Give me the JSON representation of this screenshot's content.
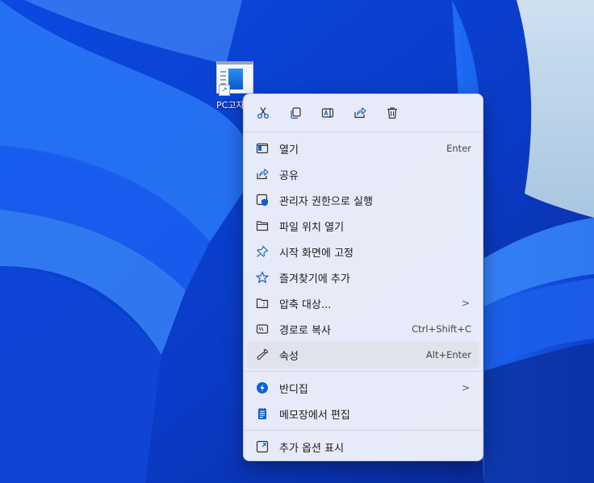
{
  "desktop": {
    "icon_label": "PC고자"
  },
  "toolbar": [
    {
      "name": "cut-icon"
    },
    {
      "name": "copy-icon"
    },
    {
      "name": "rename-icon"
    },
    {
      "name": "share-icon"
    },
    {
      "name": "delete-icon"
    }
  ],
  "menu": {
    "open": {
      "label": "열기",
      "shortcut": "Enter",
      "icon": "window-open-icon"
    },
    "share": {
      "label": "공유",
      "icon": "share-icon"
    },
    "run_admin": {
      "label": "관리자 권한으로 실행",
      "icon": "shield-window-icon"
    },
    "open_location": {
      "label": "파일 위치 열기",
      "icon": "folder-icon"
    },
    "pin_start": {
      "label": "시작 화면에 고정",
      "icon": "pin-icon"
    },
    "add_favorites": {
      "label": "즐겨찾기에 추가",
      "icon": "star-icon"
    },
    "compress": {
      "label": "압축 대상...",
      "icon": "zip-folder-icon"
    },
    "copy_path": {
      "label": "경로로 복사",
      "shortcut": "Ctrl+Shift+C",
      "icon": "path-icon"
    },
    "properties": {
      "label": "속성",
      "shortcut": "Alt+Enter",
      "icon": "wrench-icon"
    },
    "bandizip": {
      "label": "반디집",
      "icon": "bandizip-icon"
    },
    "edit_notepad": {
      "label": "메모장에서 편집",
      "icon": "notepad-icon"
    },
    "more_options": {
      "label": "추가 옵션 표시",
      "icon": "expand-icon"
    }
  },
  "colors": {
    "accent": "#0a63d4",
    "menu_bg": "#eef1fa",
    "hover_bg": "#e0e3ec"
  }
}
